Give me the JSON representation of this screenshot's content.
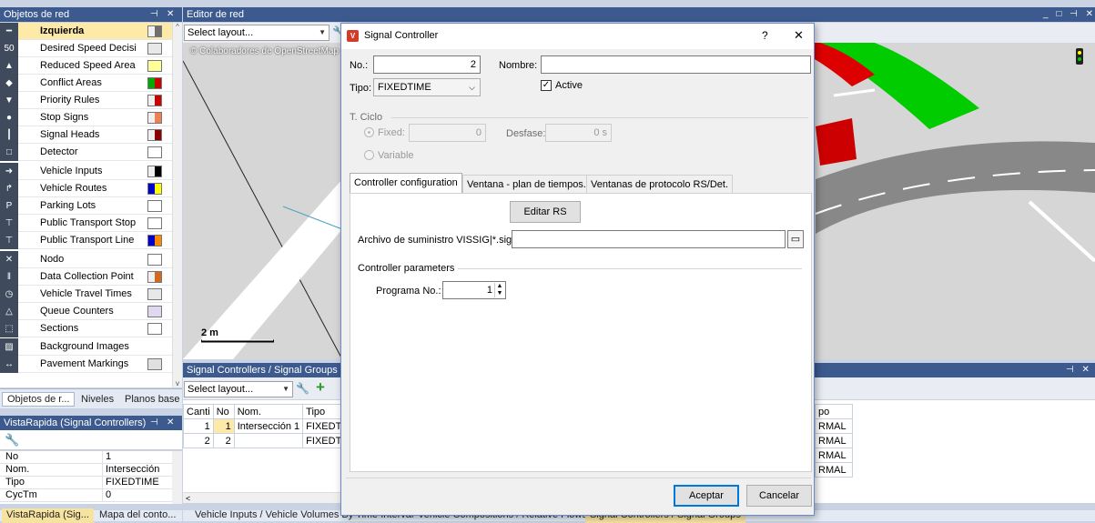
{
  "left_panel": {
    "title": "Objetos de red",
    "items": [
      {
        "label": "Izquierda",
        "icon": "road-icon",
        "swatch": "#6e6e6e",
        "swatch2": "#f0f0f0"
      },
      {
        "label": "Desired Speed Decisi",
        "icon": "speed-limit-icon",
        "swatch": "#e8e8e8"
      },
      {
        "label": "Reduced Speed Area",
        "icon": "reduced-speed-icon",
        "swatch": "#ffff99"
      },
      {
        "label": "Conflict Areas",
        "icon": "conflict-area-icon",
        "swatch": "#cc0000",
        "swatch2": "#00aa00"
      },
      {
        "label": "Priority Rules",
        "icon": "yield-icon",
        "swatch": "#cc0000",
        "swatch2": "#f0f0f0"
      },
      {
        "label": "Stop Signs",
        "icon": "stop-sign-icon",
        "swatch": "#f08050",
        "swatch2": "#f0f0f0"
      },
      {
        "label": "Signal Heads",
        "icon": "traffic-light-icon",
        "swatch": "#8b0000",
        "swatch2": "#f0f0f0"
      },
      {
        "label": "Detector",
        "icon": "detector-icon",
        "swatch": "#ffffff"
      },
      {
        "label": "Vehicle Inputs",
        "icon": "vehicle-input-icon",
        "swatch": "#000000",
        "swatch2": "#f0f0f0"
      },
      {
        "label": "Vehicle Routes",
        "icon": "route-icon",
        "swatch": "#ffff00",
        "swatch2": "#0000cc"
      },
      {
        "label": "Parking Lots",
        "icon": "parking-icon",
        "swatch": "#ffffff"
      },
      {
        "label": "Public Transport Stop",
        "icon": "bus-stop-icon",
        "swatch": "#ffffff"
      },
      {
        "label": "Public Transport Line",
        "icon": "bus-line-icon",
        "swatch": "#ff8800",
        "swatch2": "#0000cc"
      },
      {
        "label": "Nodo",
        "icon": "node-icon",
        "swatch": "#ffffff"
      },
      {
        "label": "Data Collection Point",
        "icon": "data-point-icon",
        "swatch": "#d2691e",
        "swatch2": "#f0f0f0"
      },
      {
        "label": "Vehicle Travel Times",
        "icon": "travel-time-icon",
        "swatch": "#e8e8e8"
      },
      {
        "label": "Queue Counters",
        "icon": "queue-counter-icon",
        "swatch": "#e0d8f0"
      },
      {
        "label": "Sections",
        "icon": "section-icon",
        "swatch": "#ffffff"
      },
      {
        "label": "Background Images",
        "icon": "background-image-icon",
        "swatch": "none"
      },
      {
        "label": "Pavement Markings",
        "icon": "pavement-marking-icon",
        "swatch": "#e0e0e0"
      }
    ],
    "bottom_tabs": [
      "Objetos de r...",
      "Niveles",
      "Planos base"
    ]
  },
  "quick_view": {
    "title": "VistaRapida (Signal Controllers)",
    "rows": [
      {
        "key": "No",
        "value": "1"
      },
      {
        "key": "Nom.",
        "value": "Intersección"
      },
      {
        "key": "Tipo",
        "value": "FIXEDTIME"
      },
      {
        "key": "CycTm",
        "value": "0"
      }
    ],
    "bottom_tabs": [
      "VistaRapida (Sig...",
      "Mapa del conto..."
    ]
  },
  "editor": {
    "title": "Editor de red",
    "layout_combo": "Select layout...",
    "map_credit": "© Colaboradores de OpenStreetMap",
    "scale_label": "2 m"
  },
  "signal_list": {
    "title": "Signal Controllers / Signal Groups",
    "layout_combo": "Select layout...",
    "columns": [
      "Canti",
      "No",
      "Nom.",
      "Tipo"
    ],
    "rows": [
      {
        "count": "1",
        "no": "1",
        "name": "Intersección 1",
        "type": "FIXEDTIM"
      },
      {
        "count": "2",
        "no": "2",
        "name": "",
        "type": "FIXEDTIM"
      }
    ],
    "right_header": "po",
    "right_values": [
      "RMAL",
      "RMAL",
      "RMAL",
      "RMAL"
    ]
  },
  "bottom_tabs": [
    "Vehicle Inputs / Vehicle Volumes By Time Interval",
    "Vehicle Compositions / Relative Flows",
    "Signal Controllers / Signal Groups"
  ],
  "dialog": {
    "title": "Signal Controller",
    "help": "?",
    "close": "✕",
    "no_label": "No.:",
    "no_value": "2",
    "name_label": "Nombre:",
    "name_value": "",
    "type_label": "Tipo:",
    "type_value": "FIXEDTIME",
    "active_label": "Active",
    "cycle_group": "T. Ciclo",
    "fixed_label": "Fixed:",
    "fixed_value": "0",
    "offset_label": "Desfase:",
    "offset_value": "0 s",
    "variable_label": "Variable",
    "tabs": [
      "Controller configuration",
      "Ventana - plan de tiempos.",
      "Ventanas de protocolo RS/Det."
    ],
    "edit_rs": "Editar RS",
    "supply_label": "Archivo de suministro VISSIG|*.sig:",
    "supply_value": "",
    "params_group": "Controller parameters",
    "program_label": "Programa No.:",
    "program_value": "1",
    "ok": "Aceptar",
    "cancel": "Cancelar"
  }
}
